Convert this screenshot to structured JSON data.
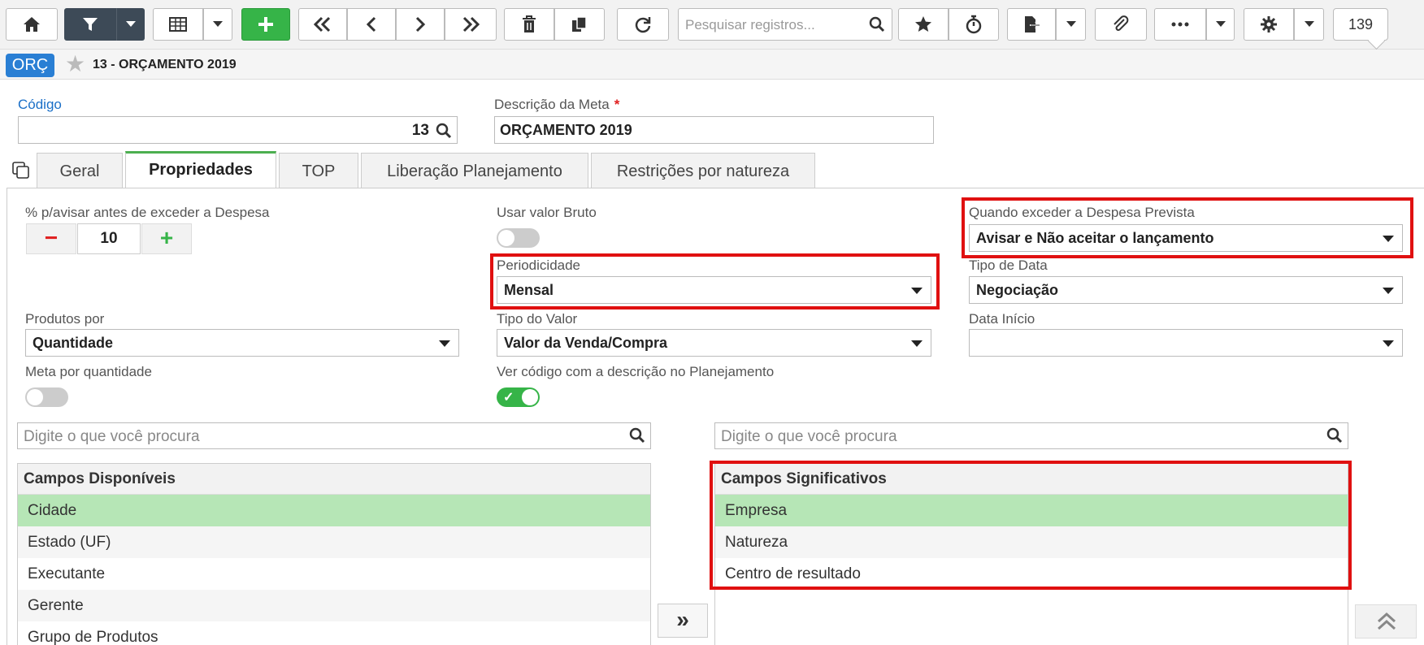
{
  "toolbar": {
    "search_placeholder": "Pesquisar registros...",
    "record_count": "139",
    "icons": [
      "home-icon",
      "filter-icon",
      "grid-icon",
      "add-icon",
      "first-icon",
      "prev-icon",
      "next-icon",
      "last-icon",
      "delete-icon",
      "copy-icon",
      "refresh-icon",
      "favorite-icon",
      "timer-icon",
      "export-icon",
      "attach-icon",
      "more-icon",
      "settings-icon"
    ]
  },
  "header": {
    "badge": "ORÇ",
    "title": "13 - ORÇAMENTO 2019"
  },
  "form": {
    "codigo_label": "Código",
    "codigo_value": "13",
    "descricao_label": "Descrição da Meta",
    "descricao_required": "*",
    "descricao_value": "ORÇAMENTO 2019"
  },
  "tabs": [
    {
      "label": "Geral"
    },
    {
      "label": "Propriedades",
      "active": true
    },
    {
      "label": "TOP"
    },
    {
      "label": "Liberação Planejamento"
    },
    {
      "label": "Restrições por natureza"
    }
  ],
  "props": {
    "percent_label": "% p/avisar antes de exceder a Despesa",
    "percent_value": "10",
    "minus": "−",
    "plus": "+",
    "usar_bruto_label": "Usar valor Bruto",
    "usar_bruto_on": false,
    "quando_exceder_label": "Quando exceder a Despesa Prevista",
    "quando_exceder_value": "Avisar e Não aceitar o lançamento",
    "periodicidade_label": "Periodicidade",
    "periodicidade_value": "Mensal",
    "tipo_data_label": "Tipo de Data",
    "tipo_data_value": "Negociação",
    "produtos_por_label": "Produtos por",
    "produtos_por_value": "Quantidade",
    "tipo_valor_label": "Tipo do Valor",
    "tipo_valor_value": "Valor da Venda/Compra",
    "data_inicio_label": "Data Início",
    "data_inicio_value": "",
    "meta_quantidade_label": "Meta por quantidade",
    "meta_quantidade_on": false,
    "ver_codigo_label": "Ver código com a descrição no Planejamento",
    "ver_codigo_on": true
  },
  "lists": {
    "left_search_placeholder": "Digite o que você procura",
    "right_search_placeholder": "Digite o que você procura",
    "available_header": "Campos Disponíveis",
    "available": [
      "Cidade",
      "Estado (UF)",
      "Executante",
      "Gerente",
      "Grupo de Produtos"
    ],
    "significant_header": "Campos Significativos",
    "significant": [
      "Empresa",
      "Natureza",
      "Centro de resultado"
    ],
    "move_label": "»"
  },
  "colors": {
    "accent_green": "#36b448",
    "badge_blue": "#2a7fd4",
    "highlight_red": "#e01010",
    "selected_row": "#b6e6b6"
  }
}
